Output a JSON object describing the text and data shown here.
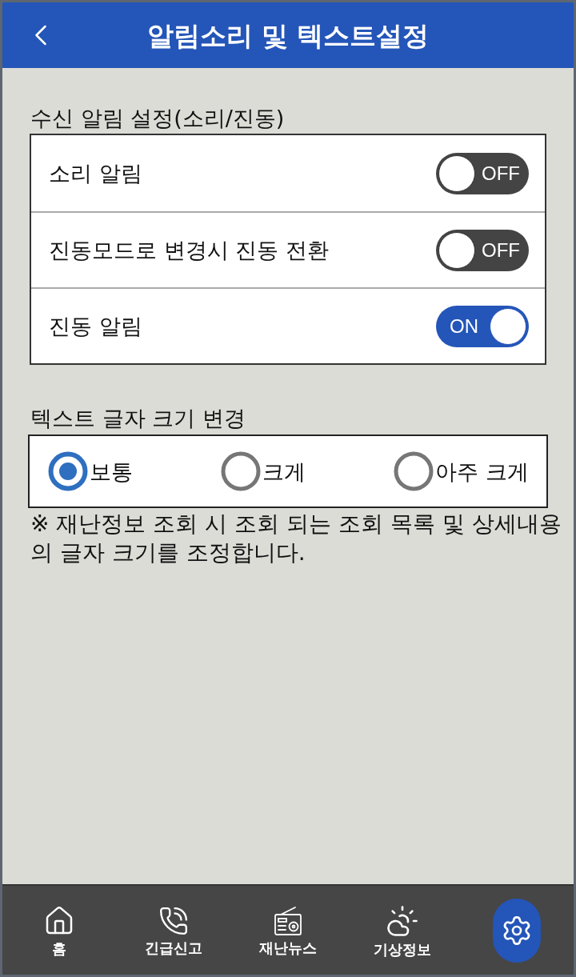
{
  "header": {
    "title": "알림소리 및 텍스트설정"
  },
  "alert_settings": {
    "heading": "수신 알림 설정(소리/진동)",
    "rows": [
      {
        "label": "소리 알림",
        "on": false,
        "toggle_text": "OFF"
      },
      {
        "label": "진동모드로 변경시 진동 전환",
        "on": false,
        "toggle_text": "OFF"
      },
      {
        "label": "진동 알림",
        "on": true,
        "toggle_text": "ON"
      }
    ]
  },
  "text_size": {
    "heading": "텍스트 글자 크기 변경",
    "options": [
      {
        "label": "보통",
        "selected": true
      },
      {
        "label": "크게",
        "selected": false
      },
      {
        "label": "아주 크게",
        "selected": false
      }
    ],
    "note": "※ 재난정보 조회 시 조회 되는 조회 목록 및 상세내용의 글자 크기를 조정합니다."
  },
  "bottom_nav": [
    {
      "kind": "home",
      "label": "홈",
      "selected": false
    },
    {
      "kind": "call",
      "label": "긴급신고",
      "selected": false
    },
    {
      "kind": "news",
      "label": "재난뉴스",
      "selected": false
    },
    {
      "kind": "weather",
      "label": "기상정보",
      "selected": false
    },
    {
      "kind": "settings",
      "selected": true
    }
  ]
}
